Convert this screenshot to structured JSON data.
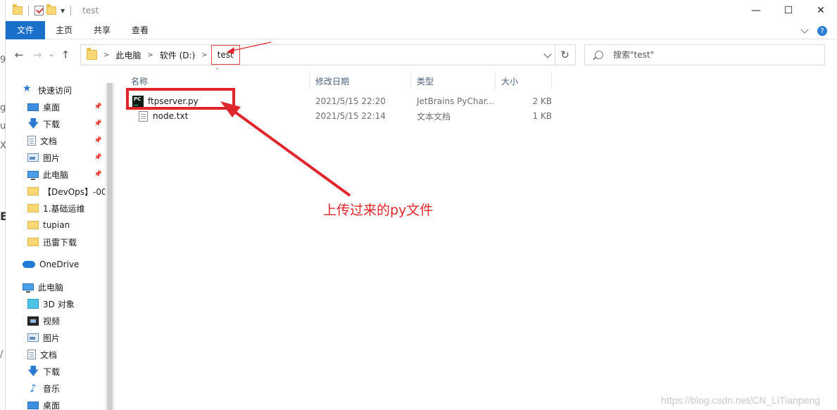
{
  "window": {
    "title": "test",
    "controls": {
      "minimize": "—",
      "maximize": "☐",
      "close": "✕"
    }
  },
  "ribbon": {
    "tabs": [
      {
        "label": "文件",
        "active": true
      },
      {
        "label": "主页"
      },
      {
        "label": "共享"
      },
      {
        "label": "查看"
      }
    ],
    "help": "?"
  },
  "address_bar": {
    "breadcrumbs": [
      "此电脑",
      "软件 (D:)",
      "test"
    ],
    "separator": ">"
  },
  "search": {
    "placeholder": "搜索\"test\""
  },
  "sidebar": {
    "items": [
      {
        "label": "快速访问",
        "icon": "star-icon",
        "level": 0,
        "pinned": false
      },
      {
        "label": "桌面",
        "icon": "desktop-icon",
        "level": 1,
        "pinned": true
      },
      {
        "label": "下载",
        "icon": "download-icon",
        "level": 1,
        "pinned": true
      },
      {
        "label": "文档",
        "icon": "document-icon",
        "level": 1,
        "pinned": true
      },
      {
        "label": "图片",
        "icon": "picture-icon",
        "level": 1,
        "pinned": true
      },
      {
        "label": "此电脑",
        "icon": "computer-icon",
        "level": 1,
        "pinned": true
      },
      {
        "label": "【DevOps】-00",
        "icon": "folder-icon",
        "level": 1,
        "pinned": false
      },
      {
        "label": "1.基础运维",
        "icon": "folder-icon",
        "level": 1,
        "pinned": false
      },
      {
        "label": "tupian",
        "icon": "folder-icon",
        "level": 1,
        "pinned": false
      },
      {
        "label": "迅雷下载",
        "icon": "folder-icon",
        "level": 1,
        "pinned": false
      },
      {
        "label": "OneDrive",
        "icon": "cloud-icon",
        "level": 0,
        "pinned": false
      },
      {
        "label": "此电脑",
        "icon": "computer-icon",
        "level": 0,
        "pinned": false
      },
      {
        "label": "3D 对象",
        "icon": "cube-icon",
        "level": 1,
        "pinned": false
      },
      {
        "label": "视频",
        "icon": "video-icon",
        "level": 1,
        "pinned": false
      },
      {
        "label": "图片",
        "icon": "picture-icon",
        "level": 1,
        "pinned": false
      },
      {
        "label": "文档",
        "icon": "document-icon",
        "level": 1,
        "pinned": false
      },
      {
        "label": "下载",
        "icon": "download-icon",
        "level": 1,
        "pinned": false
      },
      {
        "label": "音乐",
        "icon": "music-icon",
        "level": 1,
        "pinned": false
      },
      {
        "label": "桌面",
        "icon": "desktop-icon",
        "level": 1,
        "pinned": false
      }
    ]
  },
  "file_list": {
    "columns": [
      "名称",
      "修改日期",
      "类型",
      "大小"
    ],
    "rows": [
      {
        "name": "ftpserver.py",
        "modified": "2021/5/15 22:20",
        "type": "JetBrains PyChar...",
        "size": "2 KB",
        "icon": "pycharm-file-icon"
      },
      {
        "name": "node.txt",
        "modified": "2021/5/15 22:14",
        "type": "文本文档",
        "size": "1 KB",
        "icon": "text-file-icon"
      }
    ]
  },
  "annotation": {
    "text": "上传过来的py文件",
    "color": "#e0262d"
  },
  "watermark": "https://blog.csdn.net/CN_LiTianpeng",
  "background_fragments": [
    "9",
    "g",
    "u",
    "X",
    "E",
    "/"
  ],
  "colors": {
    "accent": "#1a6fc9",
    "annotation": "#e0262d"
  }
}
